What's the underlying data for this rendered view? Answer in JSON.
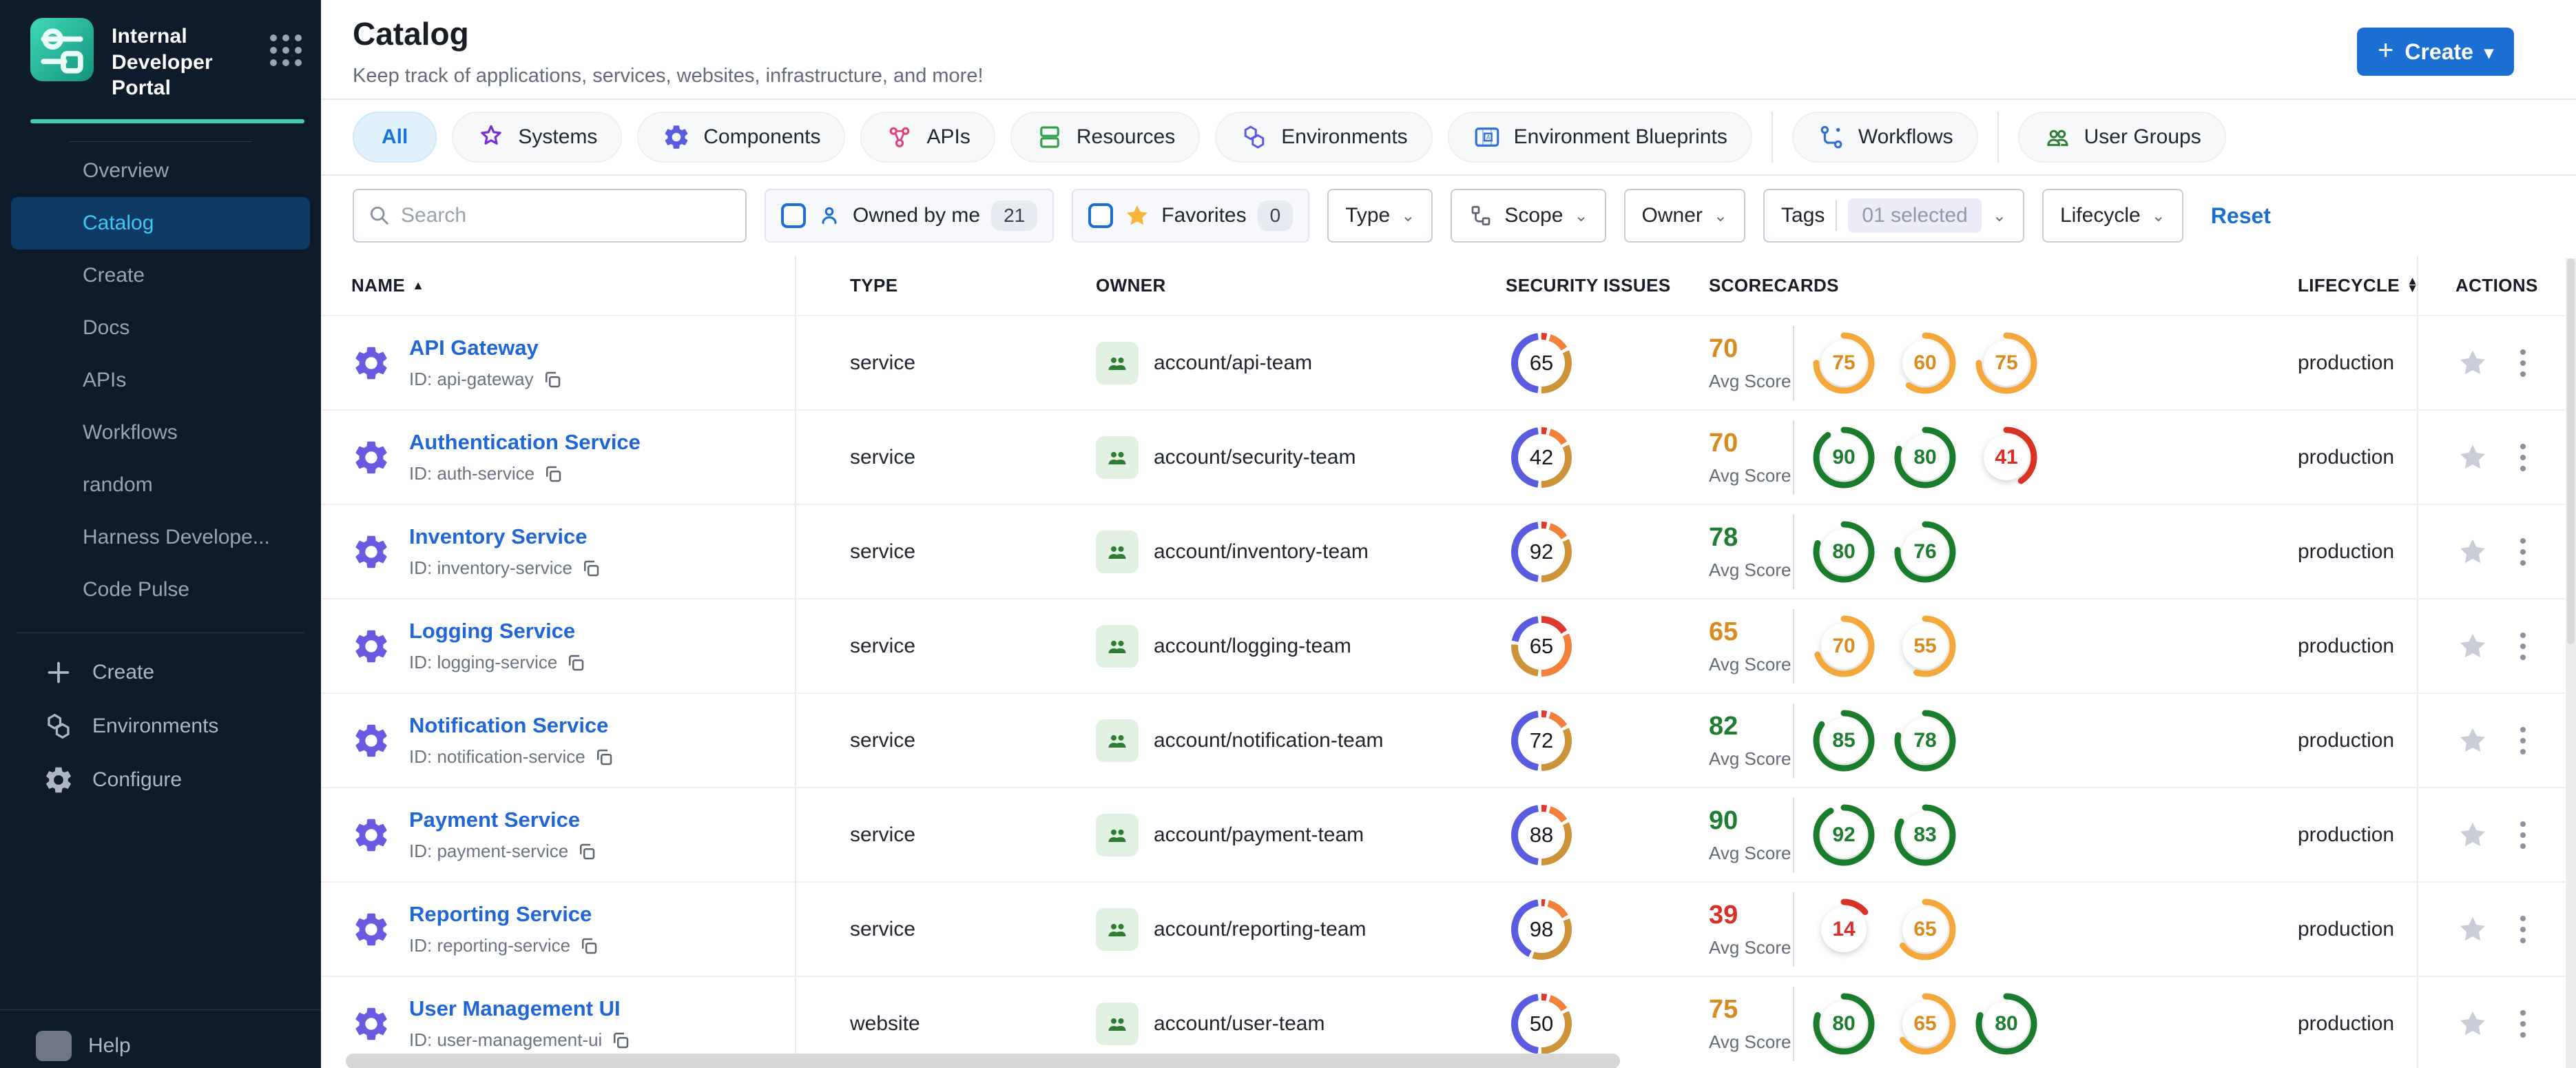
{
  "sidebar": {
    "logo_title": "Internal Developer Portal",
    "items": [
      {
        "label": "Overview",
        "active": false
      },
      {
        "label": "Catalog",
        "active": true
      },
      {
        "label": "Create",
        "active": false
      },
      {
        "label": "Docs",
        "active": false
      },
      {
        "label": "APIs",
        "active": false
      },
      {
        "label": "Workflows",
        "active": false
      },
      {
        "label": "random",
        "active": false
      },
      {
        "label": "Harness Develope...",
        "active": false
      },
      {
        "label": "Code Pulse",
        "active": false
      }
    ],
    "footer_items": [
      {
        "icon": "plus-icon",
        "label": "Create"
      },
      {
        "icon": "hexagons-icon",
        "label": "Environments"
      },
      {
        "icon": "gear-icon",
        "label": "Configure"
      }
    ],
    "help_label": "Help"
  },
  "header": {
    "title": "Catalog",
    "subtitle": "Keep track of applications, services, websites, infrastructure, and more!",
    "create_label": "Create"
  },
  "tabs": [
    {
      "label": "All",
      "active": true
    },
    {
      "label": "Systems",
      "icon": "systems",
      "color": "#7a2ed1"
    },
    {
      "label": "Components",
      "icon": "gear",
      "color": "#5a5be0"
    },
    {
      "label": "APIs",
      "icon": "apis",
      "color": "#e0447c"
    },
    {
      "label": "Resources",
      "icon": "resources",
      "color": "#35a04a"
    },
    {
      "label": "Environments",
      "icon": "hexagons",
      "color": "#5a5be0"
    },
    {
      "label": "Environment Blueprints",
      "icon": "blueprint",
      "color": "#2f6fd6"
    },
    {
      "divider": true
    },
    {
      "label": "Workflows",
      "icon": "workflow",
      "color": "#2f6fd6"
    },
    {
      "divider": true
    },
    {
      "label": "User Groups",
      "icon": "users",
      "color": "#2e7d32"
    }
  ],
  "filters": {
    "search_placeholder": "Search",
    "owned": {
      "label": "Owned by me",
      "count": "21"
    },
    "favorites": {
      "label": "Favorites",
      "count": "0"
    },
    "type_label": "Type",
    "scope_label": "Scope",
    "owner_label": "Owner",
    "tags_label": "Tags",
    "tags_selected": "01 selected",
    "lifecycle_label": "Lifecycle",
    "reset_label": "Reset"
  },
  "table": {
    "columns": [
      "NAME",
      "TYPE",
      "OWNER",
      "SECURITY ISSUES",
      "SCORECARDS",
      "LIFECYCLE",
      "ACTIONS"
    ],
    "avg_label": "Avg Score",
    "rows": [
      {
        "name": "API Gateway",
        "id_label": "ID: api-gateway",
        "type": "service",
        "owner": "account/api-team",
        "security": 65,
        "segments": [
          [
            "red",
            3
          ],
          [
            "orange",
            11
          ],
          [
            "gold",
            32
          ],
          [
            "blue",
            46
          ]
        ],
        "avg_score": 70,
        "scorecards": [
          75,
          60,
          75
        ],
        "lifecycle": "production"
      },
      {
        "name": "Authentication Service",
        "id_label": "ID: auth-service",
        "type": "service",
        "owner": "account/security-team",
        "security": 42,
        "segments": [
          [
            "red",
            3
          ],
          [
            "orange",
            11
          ],
          [
            "gold",
            32
          ],
          [
            "blue",
            46
          ]
        ],
        "avg_score": 70,
        "scorecards": [
          90,
          80,
          41
        ],
        "lifecycle": "production"
      },
      {
        "name": "Inventory Service",
        "id_label": "ID: inventory-service",
        "type": "service",
        "owner": "account/inventory-team",
        "security": 92,
        "segments": [
          [
            "red",
            3
          ],
          [
            "orange",
            11
          ],
          [
            "gold",
            32
          ],
          [
            "blue",
            46
          ]
        ],
        "avg_score": 78,
        "scorecards": [
          80,
          76
        ],
        "lifecycle": "production"
      },
      {
        "name": "Logging Service",
        "id_label": "ID: logging-service",
        "type": "service",
        "owner": "account/logging-team",
        "security": 65,
        "segments": [
          [
            "red",
            16
          ],
          [
            "orange",
            32
          ],
          [
            "gold",
            24
          ],
          [
            "blue",
            20
          ]
        ],
        "avg_score": 65,
        "scorecards": [
          70,
          55
        ],
        "lifecycle": "production"
      },
      {
        "name": "Notification Service",
        "id_label": "ID: notification-service",
        "type": "service",
        "owner": "account/notification-team",
        "security": 72,
        "segments": [
          [
            "red",
            3
          ],
          [
            "orange",
            11
          ],
          [
            "gold",
            32
          ],
          [
            "blue",
            46
          ]
        ],
        "avg_score": 82,
        "scorecards": [
          85,
          78
        ],
        "lifecycle": "production"
      },
      {
        "name": "Payment Service",
        "id_label": "ID: payment-service",
        "type": "service",
        "owner": "account/payment-team",
        "security": 88,
        "segments": [
          [
            "red",
            3
          ],
          [
            "orange",
            11
          ],
          [
            "gold",
            32
          ],
          [
            "blue",
            46
          ]
        ],
        "avg_score": 90,
        "scorecards": [
          92,
          83
        ],
        "lifecycle": "production"
      },
      {
        "name": "Reporting Service",
        "id_label": "ID: reporting-service",
        "type": "service",
        "owner": "account/reporting-team",
        "security": 98,
        "segments": [
          [
            "red",
            2
          ],
          [
            "orange",
            13
          ],
          [
            "gold",
            36
          ],
          [
            "blue",
            41
          ]
        ],
        "avg_score": 39,
        "scorecards": [
          14,
          65
        ],
        "lifecycle": "production"
      },
      {
        "name": "User Management UI",
        "id_label": "ID: user-management-ui",
        "type": "website",
        "owner": "account/user-team",
        "security": 50,
        "segments": [
          [
            "red",
            3
          ],
          [
            "orange",
            11
          ],
          [
            "gold",
            32
          ],
          [
            "blue",
            46
          ]
        ],
        "avg_score": 75,
        "scorecards": [
          80,
          65,
          80
        ],
        "lifecycle": "production"
      }
    ]
  },
  "colors": {
    "tone_green": "#1e7d32",
    "tone_orange": "#d78b21",
    "tone_red": "#da2f28",
    "ring_green": "#1b7d2c",
    "ring_orange": "#f4a73a",
    "ring_red": "#d93328",
    "seg_blue": "#5a5be0",
    "seg_red": "#e0382e",
    "seg_orange": "#f5803c",
    "seg_gold": "#cd9338",
    "accent_blue": "#1b6fd2",
    "sidebar_bg": "#0e1b2b",
    "active_nav": "#0f3a66"
  }
}
